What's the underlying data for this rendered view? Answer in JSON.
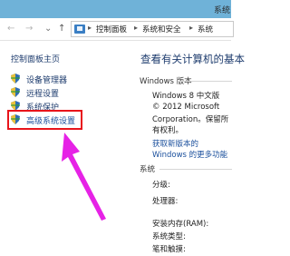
{
  "window": {
    "title_fragment": "系统"
  },
  "address": {
    "crumbs": [
      "控制面板",
      "系统和安全",
      "系统"
    ],
    "separator": "▸"
  },
  "nav": {
    "back": "←",
    "forward": "→",
    "dropdown": "⌄",
    "up": "↑"
  },
  "sidebar": {
    "title": "控制面板主页",
    "items": [
      {
        "label": "设备管理器",
        "icon": "shield-icon"
      },
      {
        "label": "远程设置",
        "icon": "shield-icon"
      },
      {
        "label": "系统保护",
        "icon": "shield-icon"
      },
      {
        "label": "高级系统设置",
        "icon": "shield-icon",
        "highlighted": true
      }
    ]
  },
  "main": {
    "title": "查看有关计算机的基本",
    "windows_edition": {
      "heading": "Windows 版本",
      "edition": "Windows 8 中文版",
      "copyright_lines": [
        "© 2012 Microsoft",
        "Corporation。保留所",
        "有权利。"
      ],
      "link_lines": [
        "获取新版本的",
        "Windows 的更多功能"
      ]
    },
    "system": {
      "heading": "系统",
      "rows": [
        "分级:",
        "处理器:",
        "安装内存(RAM):",
        "系统类型:",
        "笔和触摸:"
      ]
    }
  },
  "colors": {
    "titlebar": "#6fb2d8",
    "highlight_box": "#e8141b",
    "arrow": "#e622e6",
    "link": "#1a4f9c"
  }
}
